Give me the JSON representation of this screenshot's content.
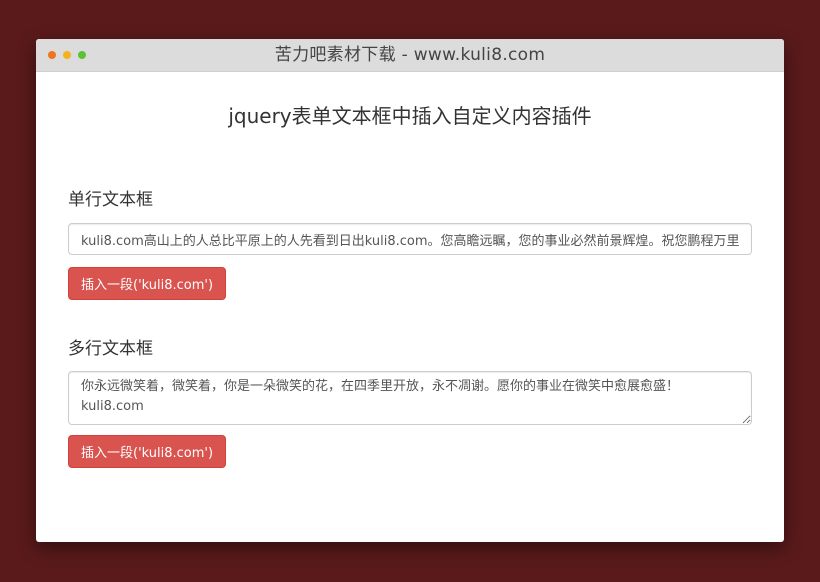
{
  "window": {
    "title": "苦力吧素材下载 - www.kuli8.com",
    "dots": [
      {
        "name": "close",
        "color": "#f0731f"
      },
      {
        "name": "minimize",
        "color": "#f2b31c"
      },
      {
        "name": "maximize",
        "color": "#5cc234"
      }
    ]
  },
  "page": {
    "title": "jquery表单文本框中插入自定义内容插件"
  },
  "single_line": {
    "label": "单行文本框",
    "value": "kuli8.com高山上的人总比平原上的人先看到日出kuli8.com。您高瞻远瞩，您的事业必然前景辉煌。祝您鹏程万里！",
    "button_label": "插入一段('kuli8.com')"
  },
  "multi_line": {
    "label": "多行文本框",
    "value": "你永远微笑着，微笑着，你是一朵微笑的花，在四季里开放，永不凋谢。愿你的事业在微笑中愈展愈盛！\nkuli8.com",
    "button_label": "插入一段('kuli8.com')"
  },
  "colors": {
    "background": "#5a1a1b",
    "button": "#d9534f"
  }
}
